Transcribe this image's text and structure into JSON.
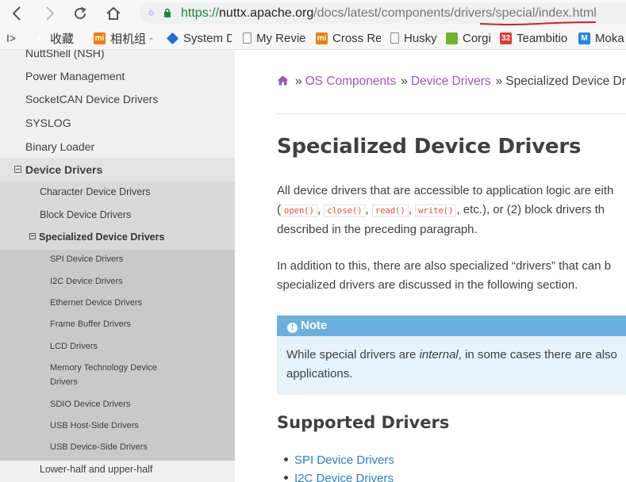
{
  "browser": {
    "url_scheme": "https://",
    "url_host": "nuttx.apache.org",
    "url_path": "/docs/latest/components/drivers/special/index.html"
  },
  "bookmarks": [
    {
      "label": "收藏",
      "icon": "star-icon"
    },
    {
      "label": "相机组",
      "icon": "mi-icon"
    },
    {
      "label": "System D",
      "icon": "diamond-icon"
    },
    {
      "label": "My Revie",
      "icon": "page-icon"
    },
    {
      "label": "Cross Ref",
      "icon": "mi-icon"
    },
    {
      "label": "Husky",
      "icon": "page-icon"
    },
    {
      "label": "Corgi",
      "icon": "leaf-icon"
    },
    {
      "label": "Teambitio",
      "icon": "badge-32-icon"
    },
    {
      "label": "Moka",
      "icon": "moka-icon"
    }
  ],
  "bookmark_badge": "32",
  "bookmark_mi": "mi",
  "bookmark_moka": "M",
  "sidebar": {
    "top_items": [
      "NuttShell (NSH)",
      "Power Management",
      "SocketCAN Device Drivers",
      "SYSLOG",
      "Binary Loader"
    ],
    "current": "Device Drivers",
    "sub_items": [
      "Character Device Drivers",
      "Block Device Drivers"
    ],
    "sub_current": "Specialized Device Drivers",
    "leaf_items": [
      "SPI Device Drivers",
      "I2C Device Drivers",
      "Ethernet Device Drivers",
      "Frame Buffer Drivers",
      "LCD Drivers",
      "Memory Technology Device Drivers",
      "SDIO Device Drivers",
      "USB Host-Side Drivers",
      "USB Device-Side Drivers"
    ],
    "after_item": "Lower-half and upper-half"
  },
  "breadcrumb": {
    "items": [
      "OS Components",
      "Device Drivers"
    ],
    "current": "Specialized Device Drivers",
    "separator": "»"
  },
  "content": {
    "title": "Specialized Device Drivers",
    "para1_line1": "All device drivers that are accessible to application logic are eith",
    "para1_codes": [
      "open()",
      "close()",
      "read()",
      "write()"
    ],
    "para1_line2_tail": ", etc.), or (2) block drivers th",
    "para1_line3": "described in the preceding paragraph.",
    "para2_line1": "In addition to this, there are also specialized “drivers” that can b",
    "para2_line2": "specialized drivers are discussed in the following section.",
    "note_title": "Note",
    "note_icon": "!",
    "note_line1_a": "While special drivers are ",
    "note_line1_em": "internal",
    "note_line1_b": ", in some cases there are also",
    "note_line2": "applications.",
    "h2": "Supported Drivers",
    "links": [
      "SPI Device Drivers",
      "I2C Device Drivers"
    ]
  }
}
